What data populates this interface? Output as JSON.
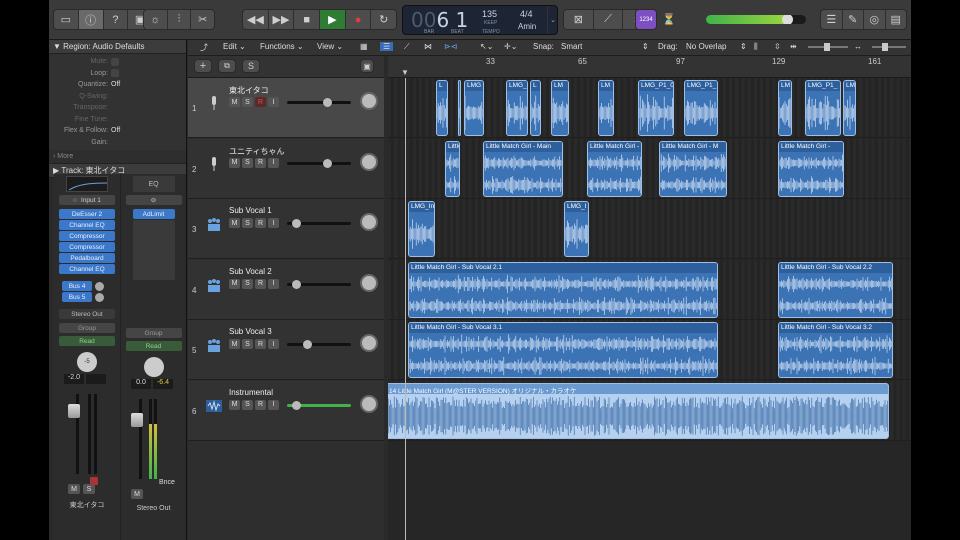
{
  "control_bar": {
    "lcd": {
      "bar": "6",
      "beat": "1",
      "bar_cap": "BAR",
      "beat_cap": "BEAT",
      "tempo": "135",
      "tempo_mode": "KEEP",
      "tempo_cap": "TEMPO",
      "sig": "4/4",
      "key": "Amin"
    },
    "count_in": "1234",
    "master_volume": 0.82
  },
  "inspector": {
    "region_header": "Region: Audio Defaults",
    "params": [
      {
        "k": "Mute:",
        "v": "",
        "disabled": true
      },
      {
        "k": "Loop:",
        "v": "",
        "disabled": false
      },
      {
        "k": "Quantize:",
        "v": "Off",
        "disabled": false
      },
      {
        "k": "Q-Swing:",
        "v": "",
        "disabled": true
      },
      {
        "k": "Transpose:",
        "v": "",
        "disabled": true
      },
      {
        "k": "Fine Tune:",
        "v": "",
        "disabled": true
      },
      {
        "k": "Flex & Follow:",
        "v": "Off",
        "disabled": false
      },
      {
        "k": "Gain:",
        "v": "",
        "disabled": false
      }
    ],
    "more": "More",
    "track_header": "Track: 東北イタコ",
    "strip1": {
      "eq_label": "",
      "input": "Input 1",
      "plugins": [
        "DeEsser 2",
        "Channel EQ",
        "Compressor",
        "Compressor",
        "Pedalboard",
        "Channel EQ"
      ],
      "sends": [
        "Bus 4",
        "Bus 5"
      ],
      "output": "Stereo Out",
      "group": "Group",
      "automation": "Read",
      "pan_value": "-5",
      "vol_value": "-2.0",
      "name": "東北イタコ"
    },
    "strip2": {
      "eq_label": "EQ",
      "plugins": [
        "AdLimit"
      ],
      "group": "Group",
      "automation": "Read",
      "vol_value": "0.0",
      "peak_value": "-6.4",
      "bounce": "Bnce",
      "name": "Stereo Out"
    }
  },
  "arrange_toolbar": {
    "edit": "Edit",
    "functions": "Functions",
    "view": "View",
    "snap_label": "Snap:",
    "snap_value": "Smart",
    "drag_label": "Drag:",
    "drag_value": "No Overlap"
  },
  "ruler": [
    "33",
    "65",
    "97",
    "129",
    "161"
  ],
  "tracks": [
    {
      "no": "1",
      "name": "東北イタコ",
      "vol": 0.63,
      "selected": true,
      "icon": "microphone-icon"
    },
    {
      "no": "2",
      "name": "ユニティちゃん",
      "vol": 0.63,
      "selected": false,
      "icon": "microphone-icon"
    },
    {
      "no": "3",
      "name": "Sub Vocal 1",
      "vol": 0.14,
      "selected": false,
      "icon": "choir-icon"
    },
    {
      "no": "4",
      "name": "Sub Vocal 2",
      "vol": 0.14,
      "selected": false,
      "icon": "choir-icon"
    },
    {
      "no": "5",
      "name": "Sub Vocal 3",
      "vol": 0.31,
      "selected": false,
      "icon": "choir-icon"
    },
    {
      "no": "6",
      "name": "Instrumental",
      "vol": 0.14,
      "selected": false,
      "icon": "waveform-icon"
    }
  ],
  "regions": {
    "track1": [
      "L",
      "",
      "LMG",
      "LMG_",
      "L",
      "LM",
      "LM",
      "LMG_P1_0",
      "LMG_P1_",
      "LM",
      "LMG_P1_",
      "LM"
    ],
    "track2": [
      "Little",
      "Little Match Girl - Main",
      "Little Match Girl - M",
      "Little Match Girl - M",
      "Little Match Girl -"
    ],
    "track3": [
      "LMG_In",
      "LMG_I"
    ],
    "track4": [
      "Little Match Girl - Sub Vocal 2.1",
      "Little Match Girl - Sub Vocal 2.2"
    ],
    "track5": [
      "Little Match Girl - Sub Vocal 3.1",
      "Little Match Girl - Sub Vocal 3.2"
    ],
    "track6": [
      "14 Little Match Girl (M@STER VERSION) オリジナル・カラオケ"
    ]
  },
  "buttons": {
    "m": "M",
    "s": "S",
    "r": "R",
    "i": "I",
    "ms_s": "S"
  }
}
